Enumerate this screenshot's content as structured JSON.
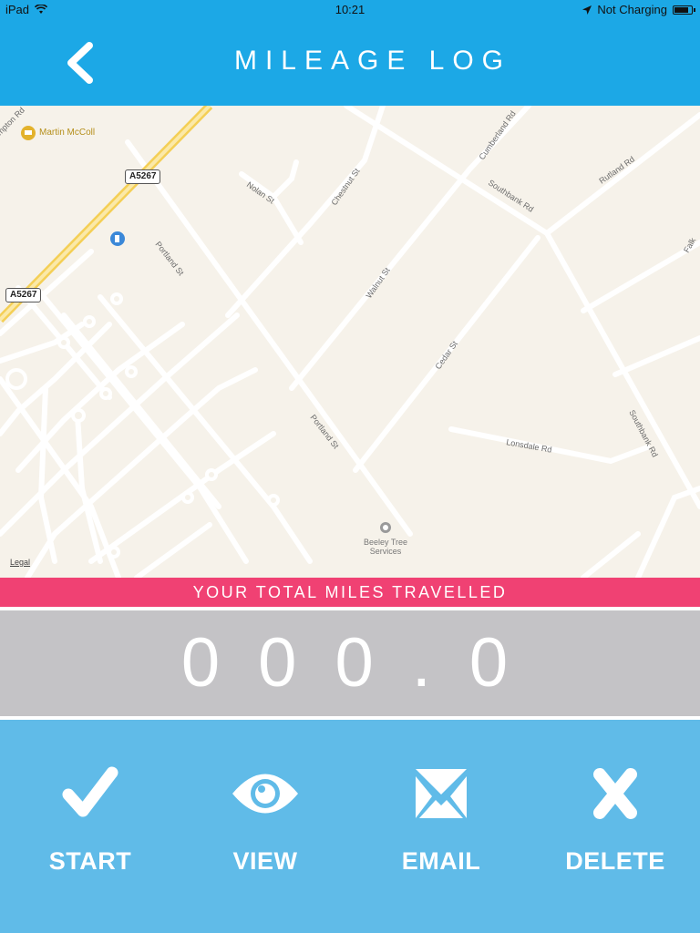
{
  "status_bar": {
    "device": "iPad",
    "time": "10:21",
    "charging": "Not Charging",
    "battery_level": 0.85
  },
  "nav": {
    "title": "MILEAGE LOG",
    "back_icon": "chevron-left-icon"
  },
  "map": {
    "shields": [
      "A5267",
      "A5267"
    ],
    "pois": {
      "shop": "Martin McColl",
      "services_line1": "Beeley Tree",
      "services_line2": "Services"
    },
    "roads": {
      "mpton": "mpton Rd",
      "nolan": "Nolan St",
      "chestnut": "Chestnut St",
      "cumberland": "Cumberland Rd",
      "southbank1": "Southbank Rd",
      "rutland": "Rutland Rd",
      "falk": "Falk",
      "portland1": "Portland St",
      "walnut": "Walnut St",
      "cedar": "Cedar St",
      "portland2": "Portland St",
      "lonsdale": "Lonsdale Rd",
      "southbank2": "Southbank Rd"
    },
    "legal": "Legal"
  },
  "banner": {
    "text": "YOUR TOTAL MILES TRAVELLED"
  },
  "odometer": {
    "value": "000.0"
  },
  "actions": [
    {
      "label": "START",
      "icon": "checkmark-icon"
    },
    {
      "label": "VIEW",
      "icon": "eye-icon"
    },
    {
      "label": "EMAIL",
      "icon": "envelope-icon"
    },
    {
      "label": "DELETE",
      "icon": "close-icon"
    }
  ],
  "colors": {
    "header": "#1ca8e6",
    "banner": "#f04173",
    "odometer_bg": "#c4c3c6",
    "actions_bg": "#60bbe8"
  }
}
